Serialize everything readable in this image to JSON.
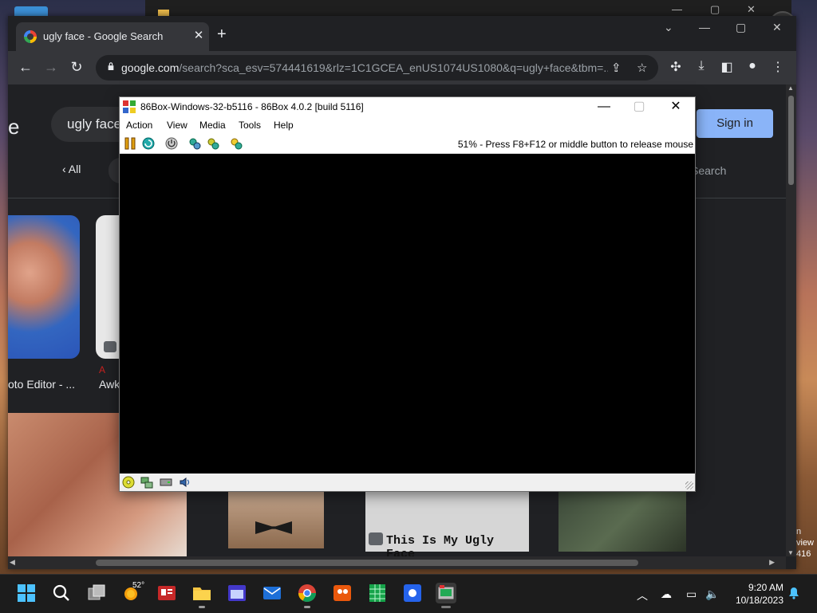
{
  "chrome": {
    "tab_title": "ugly face - Google Search",
    "tab_close": "✕",
    "new_tab": "+",
    "url_host": "google.com",
    "url_path": "/search?sca_esv=574441619&rlz=1C1GCEA_enUS1074US1080&q=ugly+face&tbm=...",
    "window_controls": [
      "⌄",
      "—",
      "▢",
      "✕"
    ]
  },
  "page": {
    "logo_fragment": "e",
    "search_query": "ugly face",
    "sign_in": "Sign in",
    "tab_all": "All",
    "search_link_fragment": "Search",
    "result1_caption": "oto Editor - ...",
    "result2_source": "A",
    "result2_caption": "Awk",
    "row2_caption": "This Is My Ugly Face"
  },
  "box86": {
    "title": "86Box-Windows-32-b5116 - 86Box 4.0.2 [build 5116]",
    "menu": [
      "Action",
      "View",
      "Media",
      "Tools",
      "Help"
    ],
    "status_message": "51% - Press F8+F12 or middle button to release mouse"
  },
  "taskbar": {
    "weather_temp": "52°",
    "time": "9:20 AM",
    "date": "10/18/2023"
  },
  "right_peek": [
    "n",
    "view",
    "416"
  ]
}
